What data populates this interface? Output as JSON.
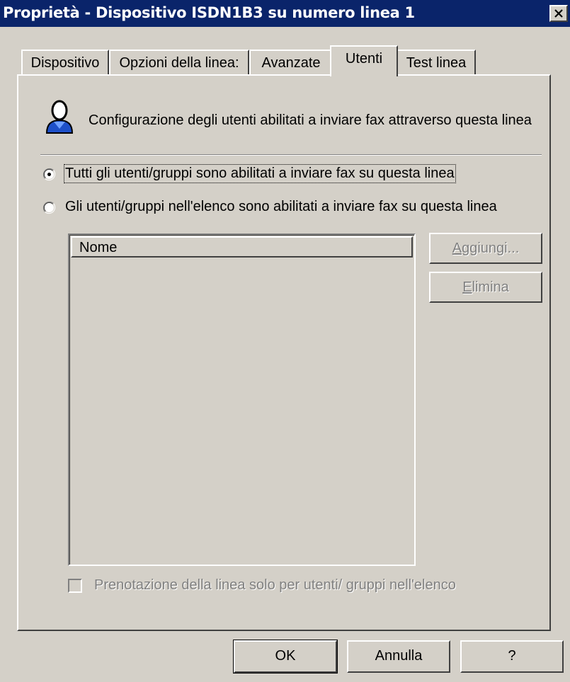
{
  "window": {
    "title": "Proprietà - Dispositivo ISDN1B3 su numero linea 1"
  },
  "tabs": [
    {
      "label": "Dispositivo"
    },
    {
      "label": "Opzioni della linea:"
    },
    {
      "label": "Avanzate"
    },
    {
      "label": "Utenti",
      "active": true
    },
    {
      "label": "Test linea"
    }
  ],
  "users_tab": {
    "icon": "user-icon",
    "description": "Configurazione degli utenti abilitati a inviare fax attraverso questa linea",
    "radio_all": {
      "label": "Tutti gli utenti/gruppi sono abilitati a inviare fax su questa linea",
      "checked": true
    },
    "radio_list": {
      "label": "Gli utenti/gruppi nell'elenco sono abilitati a inviare fax su questa linea",
      "checked": false
    },
    "list": {
      "column_header": "Nome",
      "items": []
    },
    "add_button": {
      "prefix": "A",
      "rest": "ggiungi...",
      "enabled": false
    },
    "delete_button": {
      "prefix": "E",
      "rest": "limina",
      "enabled": false
    },
    "reserve_checkbox": {
      "label": "Prenotazione della linea solo per utenti/ gruppi nell'elenco",
      "checked": false,
      "enabled": false
    }
  },
  "footer": {
    "ok_label": "OK",
    "cancel_label": "Annulla",
    "help_label": "?"
  },
  "colors": {
    "titlebar": "#0a246a",
    "face": "#d4d0c8",
    "disabled_text": "#808080"
  }
}
